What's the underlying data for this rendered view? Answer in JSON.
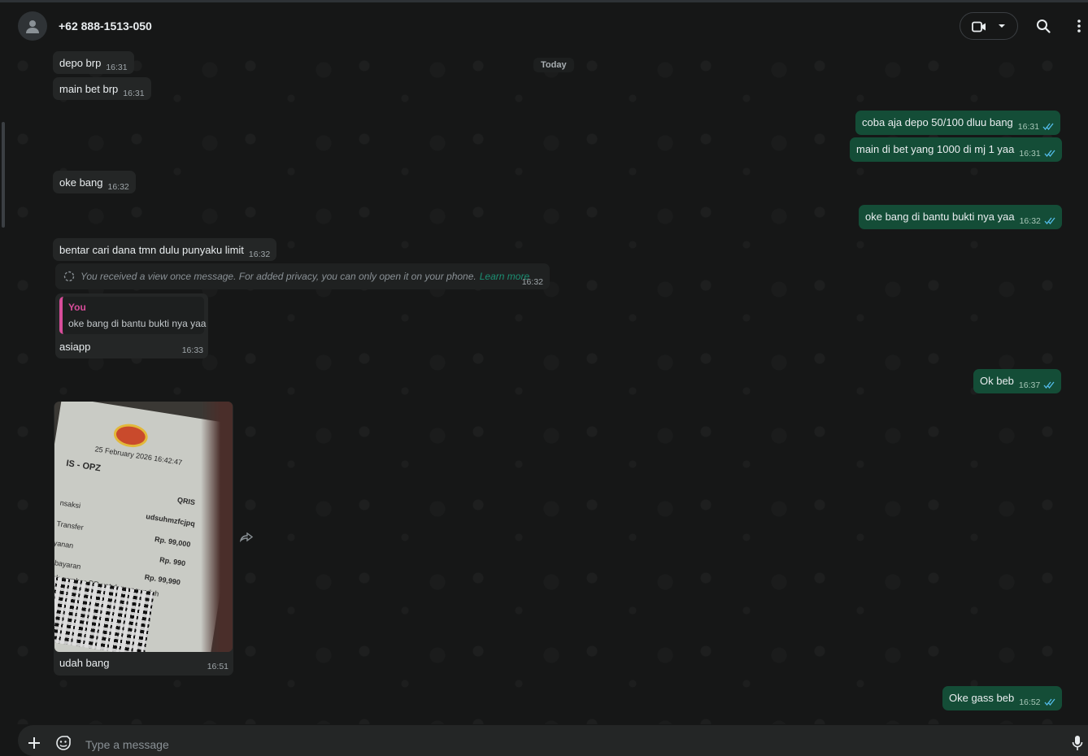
{
  "header": {
    "contact_name": "+62 888-1513-050"
  },
  "chat": {
    "date_chip": "Today",
    "messages_in": [
      {
        "text": "depo brp",
        "time": "16:31"
      },
      {
        "text": "main bet brp",
        "time": "16:31"
      },
      {
        "text": "oke bang",
        "time": "16:32"
      },
      {
        "text": "bentar cari dana tmn dulu punyaku limit",
        "time": "16:32"
      }
    ],
    "view_once": {
      "text": "You received a view once message. For added privacy, you can only open it on your phone.",
      "link": "Learn more",
      "time": "16:32"
    },
    "reply": {
      "quote_author": "You",
      "quote_text": "oke bang di bantu bukti nya yaa",
      "text": "asiapp",
      "time": "16:33"
    },
    "image_message": {
      "caption": "udah bang",
      "time": "16:51",
      "photo_text": {
        "date": "25 February 2026 16:42:47",
        "heading": "IS - OPZ",
        "brand": "QRIS",
        "label1": "nsaksi",
        "value1": "udsuhmzfcjpq",
        "label2": "Transfer",
        "value2": "Rp. 99,000",
        "label3": "yanan",
        "value3": "Rp. 990",
        "label4": "nbayaran",
        "value4": "Rp. 99,990",
        "note": "zuk gambar QR untuk mengunduh"
      }
    },
    "messages_out": [
      {
        "text": "coba aja depo 50/100 dluu bang",
        "time": "16:31"
      },
      {
        "text": "main di bet yang 1000 di mj 1 yaa",
        "time": "16:31"
      },
      {
        "text": "oke bang di bantu bukti nya yaa",
        "time": "16:32"
      },
      {
        "text": "Ok beb",
        "time": "16:37"
      },
      {
        "text": "Oke gass beb",
        "time": "16:52"
      }
    ]
  },
  "composer": {
    "placeholder": "Type a message"
  },
  "colors": {
    "incoming_bubble": "#242626",
    "outgoing_bubble": "#144d37",
    "background": "#161717",
    "quote_accent": "#d84d9a",
    "link": "#1c8f73",
    "read_tick": "#53bdeb"
  }
}
